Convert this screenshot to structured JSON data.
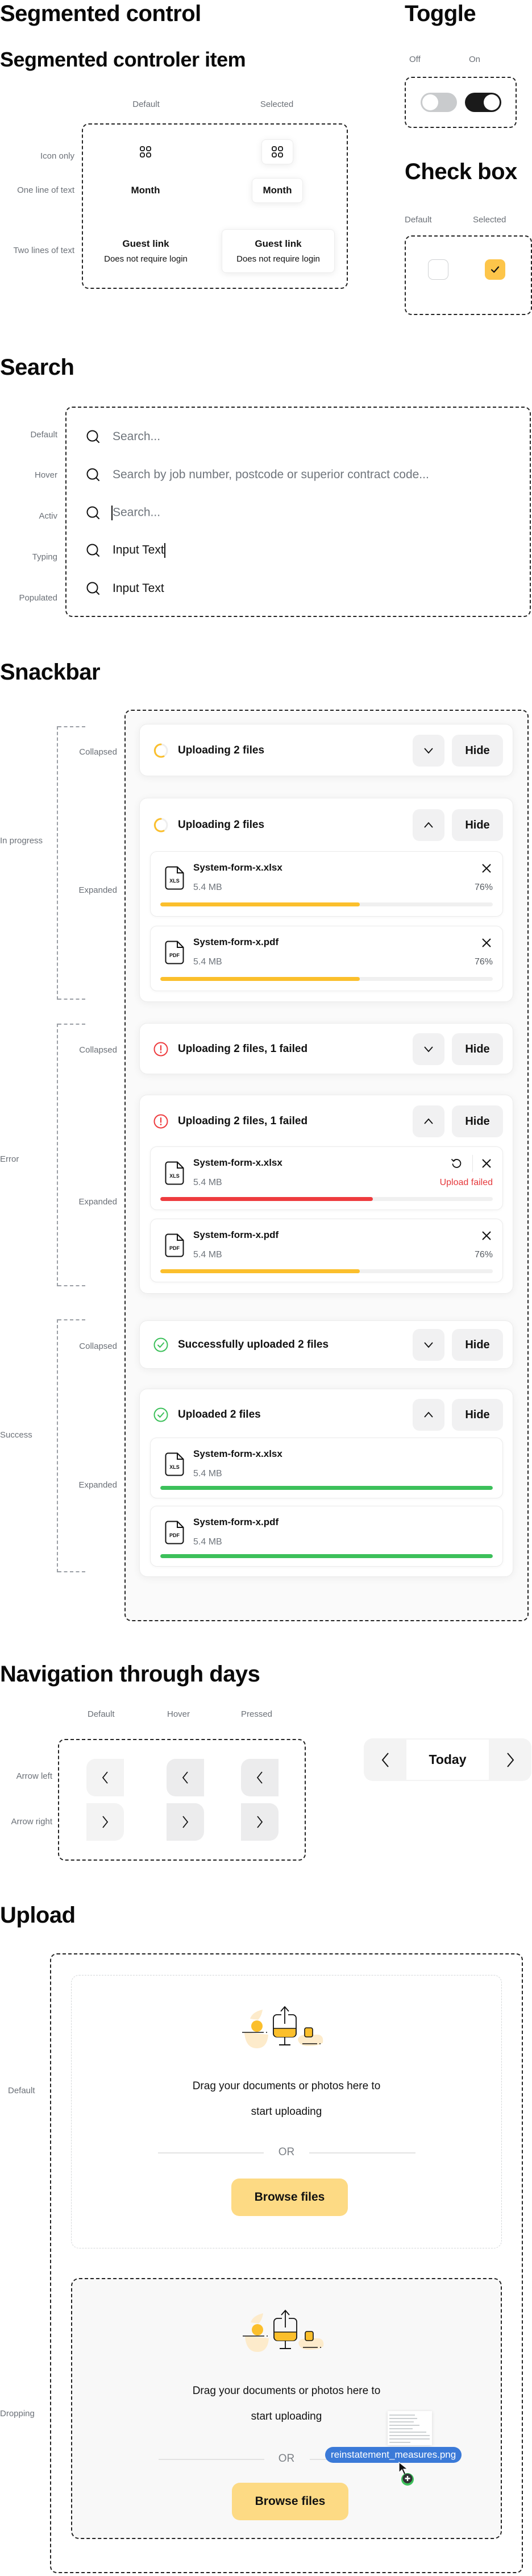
{
  "segmented": {
    "title": "Segmented control",
    "item_title": "Segmented controler item",
    "columns": [
      "Default",
      "Selected"
    ],
    "rows": [
      "Icon only",
      "One line of text",
      "Two lines of text"
    ],
    "one_line_label": "Month",
    "two_line_title": "Guest link",
    "two_line_subtitle": "Does not require login",
    "icon": "grid-icon"
  },
  "toggle": {
    "title": "Toggle",
    "columns": [
      "Off",
      "On"
    ],
    "colors": {
      "off_track": "#c9cbcd",
      "on_track": "#1a1a1a"
    }
  },
  "checkbox": {
    "title": "Check box",
    "columns": [
      "Default",
      "Selected"
    ],
    "colors": {
      "selected_fill": "#fdc54a"
    }
  },
  "search": {
    "title": "Search",
    "rows": [
      {
        "state": "Default",
        "text": "Search...",
        "kind": "placeholder"
      },
      {
        "state": "Hover",
        "text": "Search by job number, postcode or superior contract code...",
        "kind": "placeholder"
      },
      {
        "state": "Activ",
        "text": "Search...",
        "kind": "placeholder-caret"
      },
      {
        "state": "Typing",
        "text": "Input Text",
        "kind": "value-caret"
      },
      {
        "state": "Populated",
        "text": "Input Text",
        "kind": "value"
      }
    ]
  },
  "snackbar": {
    "title": "Snackbar",
    "hide_label": "Hide",
    "groups": [
      {
        "label": "In progress",
        "collapsed_label": "Collapsed",
        "expanded_label": "Expanded"
      },
      {
        "label": "Error",
        "collapsed_label": "Collapsed",
        "expanded_label": "Expanded"
      },
      {
        "label": "Success",
        "collapsed_label": "Collapsed",
        "expanded_label": "Expanded"
      }
    ],
    "in_progress": {
      "collapsed_title": "Uploading 2 files",
      "expanded_title": "Uploading 2 files",
      "files": [
        {
          "name": "System-form-x.xlsx",
          "type": "XLS",
          "size": "5.4 MB",
          "percent_label": "76%",
          "progress": 0.6
        },
        {
          "name": "System-form-x.pdf",
          "type": "PDF",
          "size": "5.4 MB",
          "percent_label": "76%",
          "progress": 0.6
        }
      ]
    },
    "error": {
      "collapsed_title": "Uploading 2 files, 1 failed",
      "expanded_title": "Uploading 2 files, 1 failed",
      "files": [
        {
          "name": "System-form-x.xlsx",
          "type": "XLS",
          "size": "5.4 MB",
          "status": "Upload failed",
          "progress": 0.64
        },
        {
          "name": "System-form-x.pdf",
          "type": "PDF",
          "size": "5.4 MB",
          "percent_label": "76%",
          "progress": 0.6
        }
      ]
    },
    "success": {
      "collapsed_title": "Successfully uploaded 2 files",
      "expanded_title": "Uploaded 2 files",
      "files": [
        {
          "name": "System-form-x.xlsx",
          "type": "XLS",
          "size": "5.4 MB",
          "progress": 1.0
        },
        {
          "name": "System-form-x.pdf",
          "type": "PDF",
          "size": "5.4 MB",
          "progress": 1.0
        }
      ]
    },
    "colors": {
      "progress": "#fbbf2c",
      "error": "#ee3b3e",
      "success": "#3cc05a"
    }
  },
  "navigation": {
    "title": "Navigation through days",
    "columns": [
      "Default",
      "Hover",
      "Pressed"
    ],
    "rows": [
      "Arrow left",
      "Arrow right"
    ],
    "today_label": "Today"
  },
  "upload": {
    "title": "Upload",
    "states": [
      "Default",
      "Dropping"
    ],
    "prompt_line1": "Drag your documents or photos here to",
    "prompt_line2": "start uploading",
    "or_label": "OR",
    "browse_label": "Browse files",
    "dragged_file": "reinstatement_measures.png",
    "colors": {
      "accent": "#fdda84",
      "drag_chip": "#3b7ad8"
    }
  }
}
